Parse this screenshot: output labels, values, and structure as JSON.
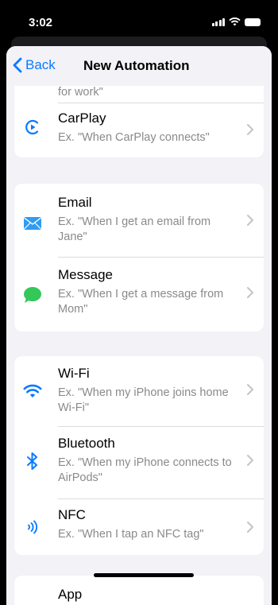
{
  "status": {
    "time": "3:02"
  },
  "nav": {
    "back_label": "Back",
    "title": "New Automation"
  },
  "partial_top_text": "for work\"",
  "card1": {
    "carplay": {
      "title": "CarPlay",
      "subtitle": "Ex. \"When CarPlay connects\""
    }
  },
  "card2": {
    "email": {
      "title": "Email",
      "subtitle": "Ex. \"When I get an email from Jane\""
    },
    "message": {
      "title": "Message",
      "subtitle": "Ex. \"When I get a message from Mom\""
    }
  },
  "card3": {
    "wifi": {
      "title": "Wi-Fi",
      "subtitle": "Ex. \"When my iPhone joins home Wi-Fi\""
    },
    "bluetooth": {
      "title": "Bluetooth",
      "subtitle": "Ex. \"When my iPhone connects to AirPods\""
    },
    "nfc": {
      "title": "NFC",
      "subtitle": "Ex. \"When I tap an NFC tag\""
    }
  },
  "card4": {
    "app": {
      "title": "App"
    }
  },
  "colors": {
    "accent": "#0a7aff",
    "message_green": "#34c759",
    "email_blue": "#2f9bf3"
  },
  "icons": {
    "carplay": "carplay-icon",
    "email": "envelope-icon",
    "message": "message-bubble-icon",
    "wifi": "wifi-icon",
    "bluetooth": "bluetooth-icon",
    "nfc": "nfc-icon"
  }
}
